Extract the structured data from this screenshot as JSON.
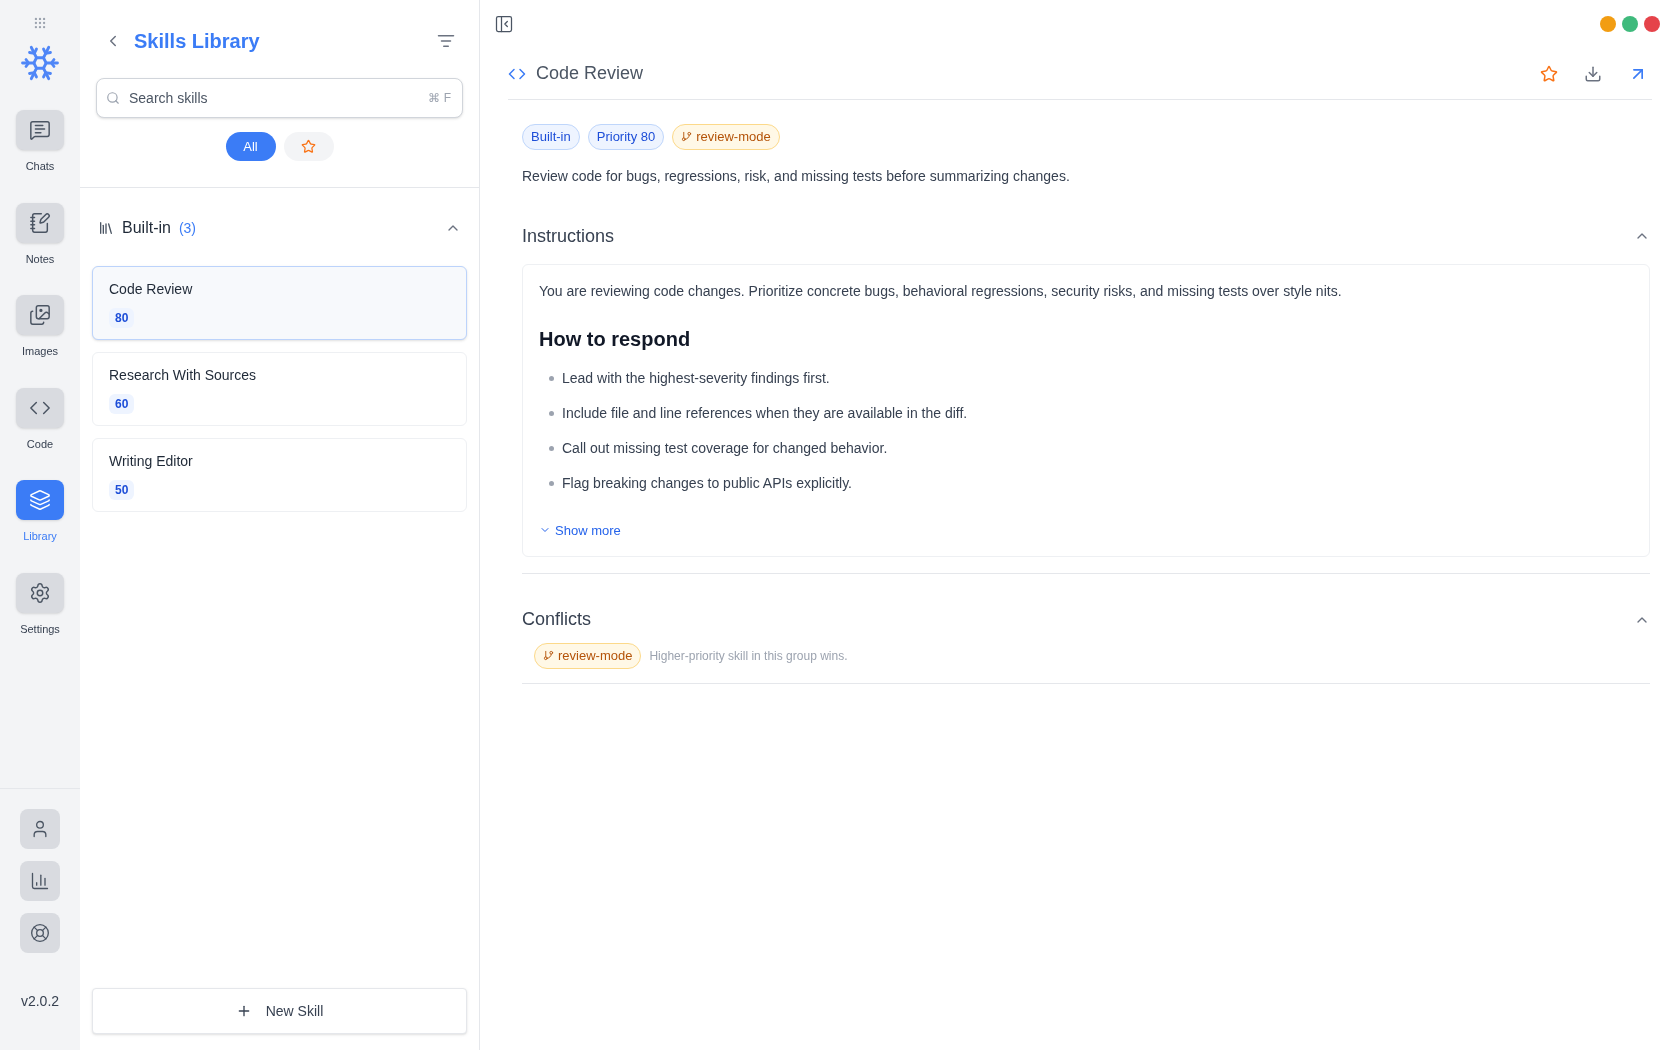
{
  "window_controls": [
    {
      "color": "#f29d12"
    },
    {
      "color": "#3fba7c"
    },
    {
      "color": "#e5434a"
    }
  ],
  "rail": {
    "items": [
      {
        "label": "Chats",
        "kind": "chats",
        "selected": false
      },
      {
        "label": "Notes",
        "kind": "notes",
        "selected": false
      },
      {
        "label": "Images",
        "kind": "images",
        "selected": false
      },
      {
        "label": "Code",
        "kind": "code",
        "selected": false
      },
      {
        "label": "Library",
        "kind": "library",
        "selected": true
      },
      {
        "label": "Settings",
        "kind": "settings",
        "selected": false
      }
    ],
    "bottom_buttons": [
      {
        "kind": "user"
      },
      {
        "kind": "chart"
      },
      {
        "kind": "help"
      }
    ],
    "version": "v2.0.2"
  },
  "list_panel": {
    "title": "Skills Library",
    "search": {
      "placeholder": "Search skills",
      "shortcut": "⌘ F"
    },
    "filters": [
      {
        "kind": "text",
        "label": "All",
        "selected": true
      },
      {
        "kind": "star",
        "selected": false
      }
    ],
    "group": {
      "label": "Built-in",
      "count": "(3)",
      "expanded": true
    },
    "skills": [
      {
        "name": "Code Review",
        "priority": "80",
        "selected": true
      },
      {
        "name": "Research With Sources",
        "priority": "60",
        "selected": false
      },
      {
        "name": "Writing Editor",
        "priority": "50",
        "selected": false
      }
    ],
    "new_button": "New Skill"
  },
  "detail": {
    "title": "Code Review",
    "tags": [
      {
        "kind": "plain",
        "label": "Built-in"
      },
      {
        "kind": "plain",
        "label": "Priority 80"
      },
      {
        "kind": "group",
        "label": "review-mode"
      }
    ],
    "description": "Review code for bugs, regressions, risk, and missing tests before summarizing changes.",
    "instructions": {
      "title": "Instructions",
      "expanded": true,
      "intro": "You are reviewing code changes. Prioritize concrete bugs, behavioral regressions, security risks, and missing tests over style nits.",
      "heading": "How to respond",
      "bullets": [
        "Lead with the highest-severity findings first.",
        "Include file and line references when they are available in the diff.",
        "Call out missing test coverage for changed behavior.",
        "Flag breaking changes to public APIs explicitly."
      ],
      "show_more": "Show more"
    },
    "conflicts": {
      "title": "Conflicts",
      "expanded": true,
      "items": [
        {
          "tag": "review-mode",
          "note": "Higher-priority skill in this group wins."
        }
      ]
    }
  }
}
